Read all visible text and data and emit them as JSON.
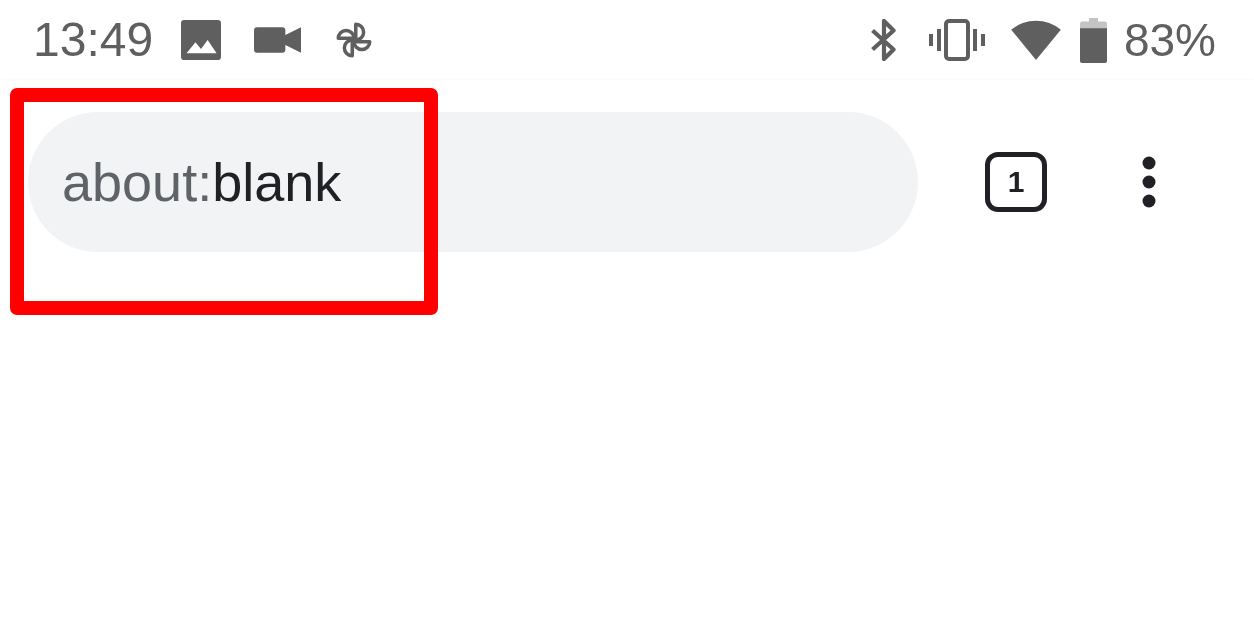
{
  "status_bar": {
    "time": "13:49",
    "battery_percent": "83%"
  },
  "toolbar": {
    "address_bar": {
      "scheme": "about:",
      "path": "blank",
      "highlighted": true
    },
    "tab_count": "1"
  }
}
